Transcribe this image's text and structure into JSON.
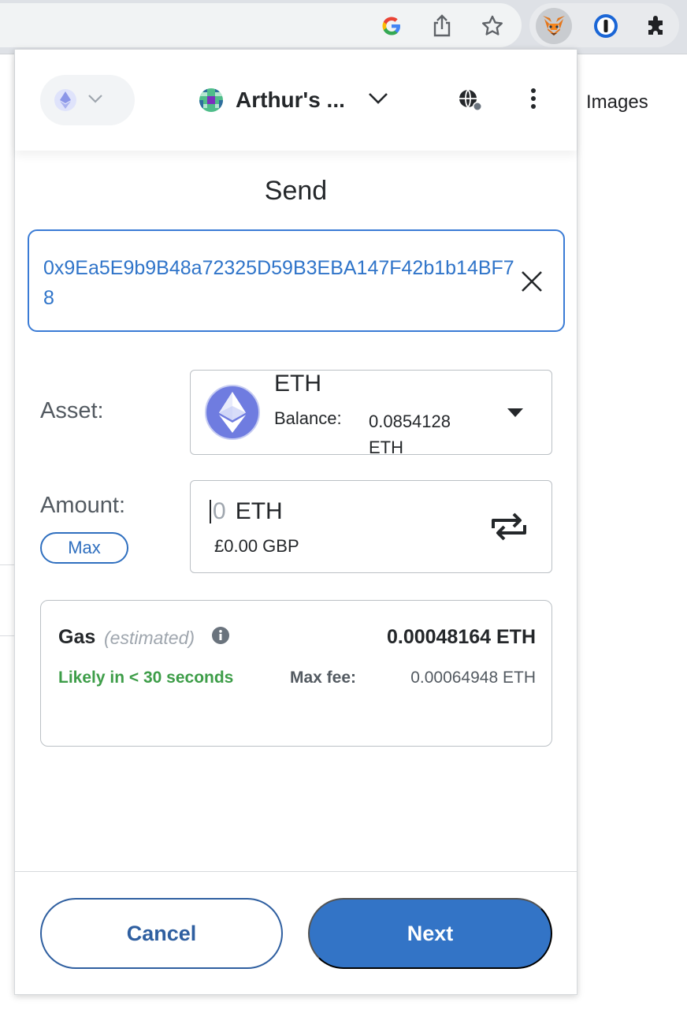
{
  "browser": {
    "icons": [
      "google-icon",
      "share-icon",
      "bookmark-star-icon",
      "metamask-fox-icon",
      "onepassword-icon",
      "extensions-puzzle-icon"
    ]
  },
  "background_page": {
    "images_link": "Images"
  },
  "header": {
    "network_icon": "ethereum-icon",
    "account_name": "Arthur's ...",
    "connected_sites_icon": "globe-icon",
    "menu_icon": "kebab-menu-icon"
  },
  "send": {
    "title": "Send",
    "recipient_address": "0x9Ea5E9b9B48a72325D59B3EBA147F42b1b14BF78"
  },
  "asset": {
    "label": "Asset:",
    "symbol": "ETH",
    "balance_label": "Balance:",
    "balance_value": "0.0854128 ETH"
  },
  "amount": {
    "label": "Amount:",
    "max_label": "Max",
    "value": "0",
    "unit": "ETH",
    "fiat": "£0.00 GBP"
  },
  "gas": {
    "title": "Gas",
    "estimated": "(estimated)",
    "amount": "0.00048164 ETH",
    "likely": "Likely in < 30 seconds",
    "max_fee_label": "Max fee:",
    "max_fee_value": "0.00064948 ETH"
  },
  "footer": {
    "cancel_label": "Cancel",
    "next_label": "Next"
  },
  "colors": {
    "primary": "#3374c6",
    "success": "#3d9d48",
    "address": "#2f74c9",
    "eth": "#6f7ce0"
  }
}
